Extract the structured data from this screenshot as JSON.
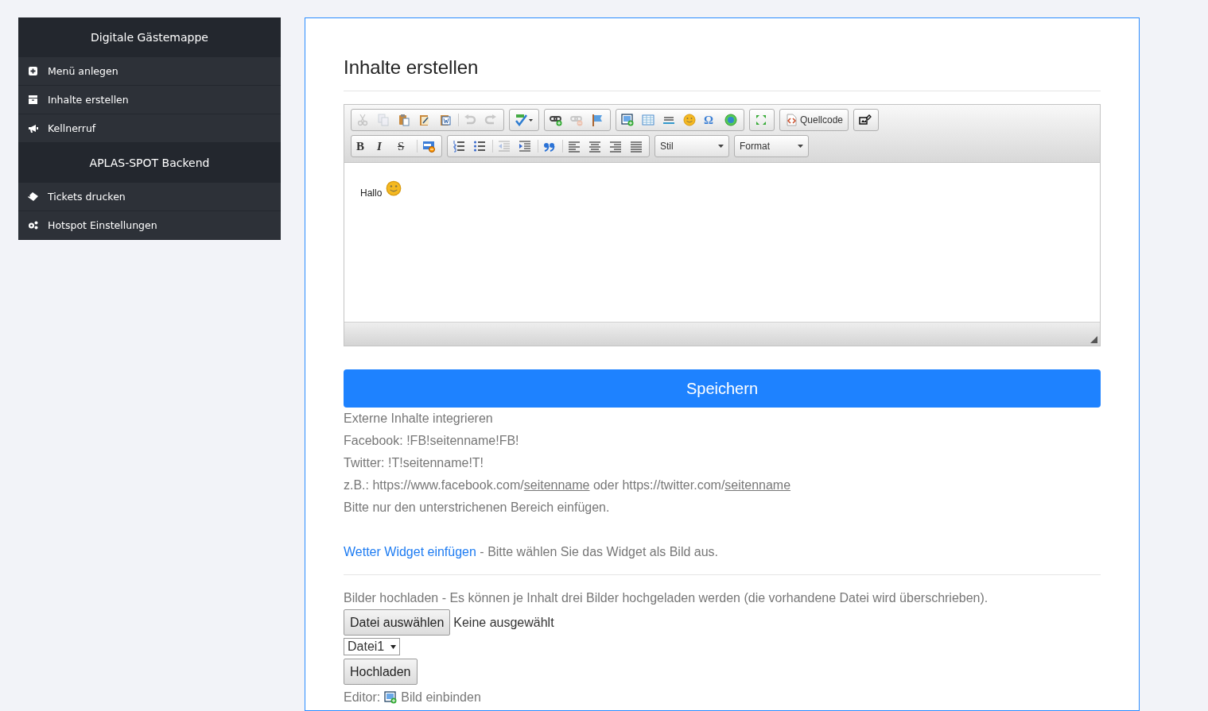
{
  "sidebar": {
    "sections": [
      {
        "title": "Digitale Gästemappe",
        "items": [
          {
            "label": "Menü anlegen"
          },
          {
            "label": "Inhalte erstellen"
          },
          {
            "label": "Kellnerruf"
          }
        ]
      },
      {
        "title": "APLAS-SPOT Backend",
        "items": [
          {
            "label": "Tickets drucken"
          },
          {
            "label": "Hotspot Einstellungen"
          }
        ]
      }
    ]
  },
  "page_title": "Inhalte erstellen",
  "editor": {
    "toolbar": [
      [
        {
          "disabled": true
        },
        {
          "disabled": true
        },
        {
          "disabled": false
        },
        {
          "disabled": false
        },
        {
          "disabled": false
        },
        {
          "kind": "separator"
        },
        {
          "disabled": true
        },
        {
          "disabled": true
        }
      ],
      [
        {
          "kind": "dropdown",
          "disabled": false
        }
      ],
      [
        {
          "disabled": false
        },
        {
          "disabled": true
        },
        {
          "disabled": false
        }
      ],
      [
        {
          "disabled": false
        },
        {
          "disabled": false
        },
        {
          "disabled": false
        },
        {
          "disabled": false
        },
        {
          "label": "Ω",
          "disabled": false
        },
        {
          "disabled": false
        }
      ],
      [
        {
          "disabled": false
        }
      ],
      [
        {
          "label": "Quellcode",
          "disabled": false
        }
      ],
      [
        {
          "disabled": false
        }
      ],
      {
        "kind": "break"
      },
      [
        {
          "label": "B",
          "disabled": false
        },
        {
          "label": "I",
          "disabled": false
        },
        {
          "label": "S",
          "disabled": false
        },
        {
          "kind": "separator"
        },
        {
          "disabled": false
        }
      ],
      [
        {
          "disabled": false
        },
        {
          "disabled": false
        },
        {
          "kind": "separator"
        },
        {
          "disabled": true
        },
        {
          "disabled": false
        },
        {
          "kind": "separator"
        },
        {
          "disabled": false
        },
        {
          "kind": "separator"
        },
        {
          "disabled": false
        },
        {
          "disabled": false
        },
        {
          "disabled": false
        },
        {
          "disabled": false
        }
      ],
      [
        {
          "kind": "combo",
          "label": "Stil"
        }
      ],
      [
        {
          "kind": "combo",
          "label": "Format"
        }
      ]
    ],
    "content": "Hallo"
  },
  "save_button": "Speichern",
  "external": {
    "heading": "Externe Inhalte integrieren",
    "lines": [
      [
        {
          "text": "Facebook: !FB!seitenname!FB!",
          "underlined": false
        }
      ],
      [
        {
          "text": "Twitter: !T!seitenname!T!",
          "underlined": false
        }
      ],
      [
        {
          "text": "z.B.: https://www.facebook.com/",
          "underlined": false
        },
        {
          "text": "seitenname",
          "underlined": true
        },
        {
          "text": " oder https://twitter.com/",
          "underlined": false
        },
        {
          "text": "seitenname",
          "underlined": true
        }
      ],
      [
        {
          "text": "Bitte nur den unterstrichenen Bereich einfügen.",
          "underlined": false
        }
      ]
    ]
  },
  "widget": {
    "link": "Wetter Widget einfügen",
    "text": " - Bitte wählen Sie das Widget als Bild aus."
  },
  "upload": {
    "hint": "Bilder hochladen - Es können je Inhalt drei Bilder hochgeladen werden (die vorhandene Datei wird überschrieben).",
    "file_button": "Datei auswählen",
    "file_status": "Keine ausgewählt",
    "file_select": "Datei1",
    "upload_button": "Hochladen",
    "editor_label": "Editor:",
    "editor_action": "Bild einbinden"
  }
}
